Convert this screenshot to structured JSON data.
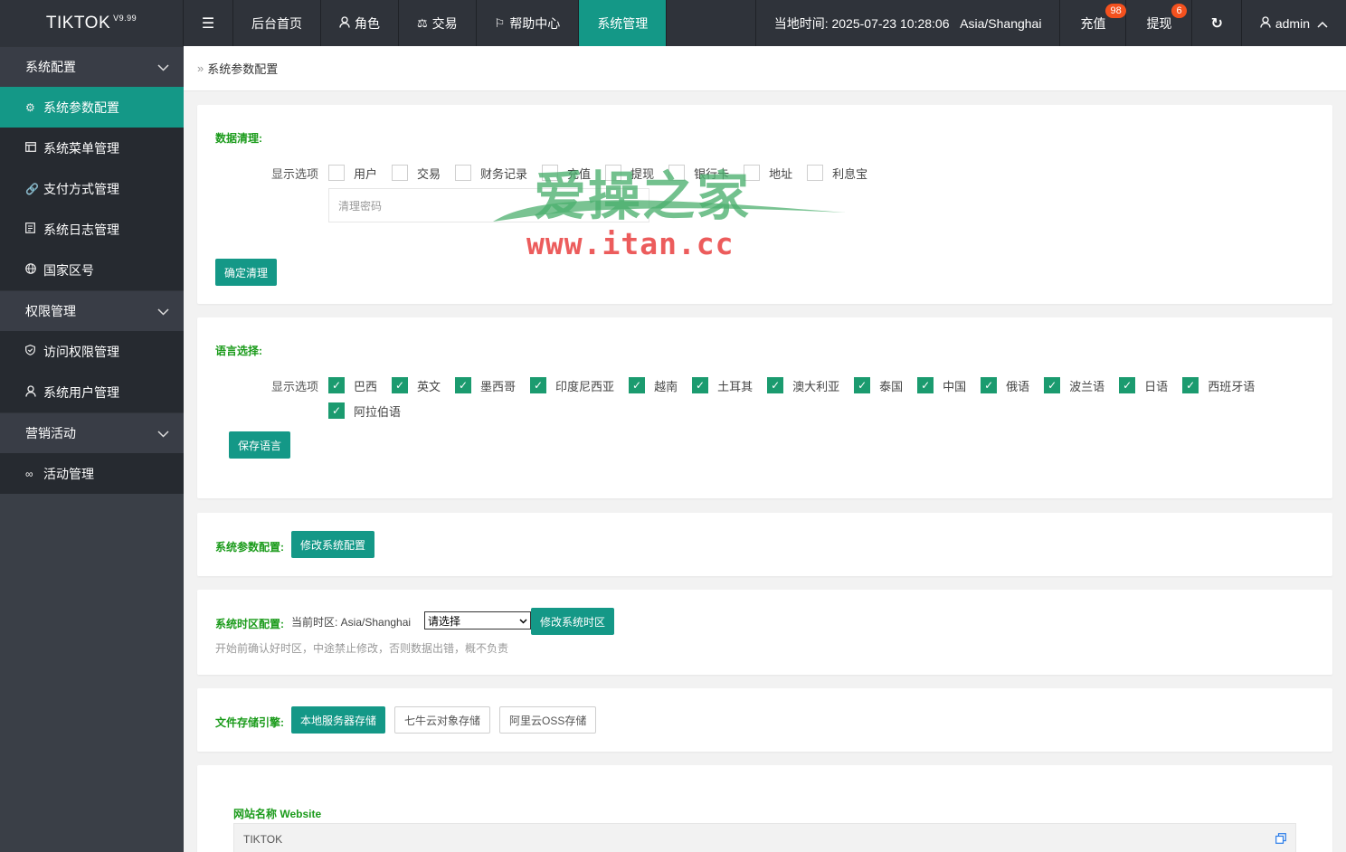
{
  "app": {
    "name": "TIKTOK",
    "version": "V9.99"
  },
  "topnav": {
    "items": [
      {
        "label": "后台首页",
        "icon": ""
      },
      {
        "label": "角色",
        "icon": "user-icon"
      },
      {
        "label": "交易",
        "icon": "scale-icon"
      },
      {
        "label": "帮助中心",
        "icon": "flag-icon"
      },
      {
        "label": "系统管理",
        "icon": "",
        "active": true
      }
    ],
    "time_label": "当地时间:",
    "time_value": "2025-07-23 10:28:06",
    "timezone": "Asia/Shanghai",
    "recharge_label": "充值",
    "recharge_badge": "98",
    "withdraw_label": "提现",
    "withdraw_badge": "6",
    "user": "admin"
  },
  "sidebar": {
    "groups": [
      {
        "label": "系统配置",
        "items": [
          {
            "label": "系统参数配置",
            "icon": "gear-icon",
            "active": true
          },
          {
            "label": "系统菜单管理",
            "icon": "window-icon"
          },
          {
            "label": "支付方式管理",
            "icon": "link-icon"
          },
          {
            "label": "系统日志管理",
            "icon": "log-icon"
          },
          {
            "label": "国家区号",
            "icon": "globe-icon"
          }
        ]
      },
      {
        "label": "权限管理",
        "items": [
          {
            "label": "访问权限管理",
            "icon": "shield-icon"
          },
          {
            "label": "系统用户管理",
            "icon": "user-icon"
          }
        ]
      },
      {
        "label": "营销活动",
        "items": [
          {
            "label": "活动管理",
            "icon": "infinity-icon"
          }
        ]
      }
    ]
  },
  "breadcrumb": {
    "label": "系统参数配置"
  },
  "data_clean": {
    "title": "数据清理:",
    "options_label": "显示选项",
    "options": [
      "用户",
      "交易",
      "财务记录",
      "充值",
      "提现",
      "银行卡",
      "地址",
      "利息宝"
    ],
    "password_placeholder": "清理密码",
    "button": "确定清理"
  },
  "language": {
    "title": "语言选择:",
    "options_label": "显示选项",
    "options": [
      "巴西",
      "英文",
      "墨西哥",
      "印度尼西亚",
      "越南",
      "土耳其",
      "澳大利亚",
      "泰国",
      "中国",
      "俄语",
      "波兰语",
      "日语",
      "西班牙语",
      "阿拉伯语"
    ],
    "button": "保存语言"
  },
  "sys_params": {
    "title": "系统参数配置:",
    "button": "修改系统配置"
  },
  "timezone_cfg": {
    "title": "系统时区配置:",
    "current_label": "当前时区: Asia/Shanghai",
    "select_value": "请选择",
    "button": "修改系统时区",
    "hint": "开始前确认好时区，中途禁止修改，否则数据出错，概不负责"
  },
  "storage": {
    "title": "文件存储引擎:",
    "options": [
      "本地服务器存储",
      "七牛云对象存储",
      "阿里云OSS存储"
    ],
    "active_index": 0
  },
  "website": {
    "label": "网站名称 Website",
    "value": "TIKTOK"
  },
  "watermark": {
    "title": "爱操之家",
    "url": "www.itan.cc"
  }
}
